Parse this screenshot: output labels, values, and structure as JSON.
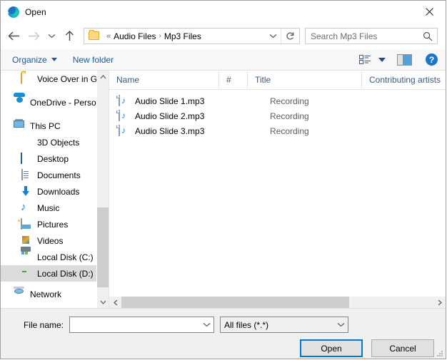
{
  "window": {
    "title": "Open",
    "logo_icon": "edge-logo-icon",
    "close_label": "✕"
  },
  "navbar": {
    "back_icon": "back-arrow-icon",
    "forward_icon": "forward-arrow-icon",
    "recent_icon": "chevron-down-icon",
    "up_icon": "up-arrow-icon",
    "breadcrumb": {
      "folder_icon": "folder-icon",
      "overflow": "«",
      "segments": [
        "Audio Files",
        "Mp3 Files"
      ],
      "separator": "›",
      "dropdown_icon": "chevron-down-icon",
      "refresh_icon": "refresh-icon"
    },
    "search": {
      "placeholder": "Search Mp3 Files",
      "value": "",
      "icon": "search-icon"
    }
  },
  "commandbar": {
    "organize_label": "Organize",
    "new_folder_label": "New folder",
    "view_icon": "view-options-icon",
    "view_caret_icon": "chevron-down-icon",
    "preview_pane_icon": "preview-pane-icon",
    "help_icon": "help-icon",
    "help_glyph": "?"
  },
  "navpane": {
    "items": [
      {
        "label": "Voice Over in Go",
        "icon": "folder-icon",
        "indent": true,
        "selected": false
      },
      {
        "label": "OneDrive - Person",
        "icon": "onedrive-cloud-icon",
        "indent": false,
        "selected": false
      },
      {
        "label": "This PC",
        "icon": "this-pc-icon",
        "indent": false,
        "selected": false
      },
      {
        "label": "3D Objects",
        "icon": "3d-objects-icon",
        "indent": true,
        "selected": false
      },
      {
        "label": "Desktop",
        "icon": "desktop-icon",
        "indent": true,
        "selected": false
      },
      {
        "label": "Documents",
        "icon": "documents-icon",
        "indent": true,
        "selected": false
      },
      {
        "label": "Downloads",
        "icon": "downloads-icon",
        "indent": true,
        "selected": false
      },
      {
        "label": "Music",
        "icon": "music-icon",
        "indent": true,
        "selected": false
      },
      {
        "label": "Pictures",
        "icon": "pictures-icon",
        "indent": true,
        "selected": false
      },
      {
        "label": "Videos",
        "icon": "videos-icon",
        "indent": true,
        "selected": false
      },
      {
        "label": "Local Disk (C:)",
        "icon": "local-disk-c-icon",
        "indent": true,
        "selected": false
      },
      {
        "label": "Local Disk (D:)",
        "icon": "local-disk-d-icon",
        "indent": true,
        "selected": true
      },
      {
        "label": "Network",
        "icon": "network-icon",
        "indent": false,
        "selected": false
      }
    ],
    "scroll_up_icon": "chevron-up-icon",
    "scroll_down_icon": "chevron-down-icon"
  },
  "filelist": {
    "columns": [
      {
        "label": "Name",
        "sorted": "asc"
      },
      {
        "label": "#",
        "sorted": ""
      },
      {
        "label": "Title",
        "sorted": ""
      },
      {
        "label": "Contributing artists",
        "sorted": ""
      }
    ],
    "rows": [
      {
        "icon": "mp3-file-icon",
        "name": "Audio Slide 1.mp3",
        "num": "",
        "title": "Recording",
        "artist": ""
      },
      {
        "icon": "mp3-file-icon",
        "name": "Audio Slide 2.mp3",
        "num": "",
        "title": "Recording",
        "artist": ""
      },
      {
        "icon": "mp3-file-icon",
        "name": "Audio Slide 3.mp3",
        "num": "",
        "title": "Recording",
        "artist": ""
      }
    ],
    "hscroll_left_icon": "chevron-left-icon",
    "hscroll_right_icon": "chevron-right-icon"
  },
  "footer": {
    "filename_label": "File name:",
    "filename_value": "",
    "filename_placeholder": "",
    "filename_dropdown_icon": "chevron-down-icon",
    "filter_value": "All files (*.*)",
    "filter_dropdown_icon": "chevron-down-icon",
    "open_label": "Open",
    "cancel_label": "Cancel"
  },
  "colors": {
    "accent": "#0078d7",
    "link": "#1b5a9e",
    "selection": "#dcdcdc",
    "column_header_text": "#3c5a80"
  }
}
